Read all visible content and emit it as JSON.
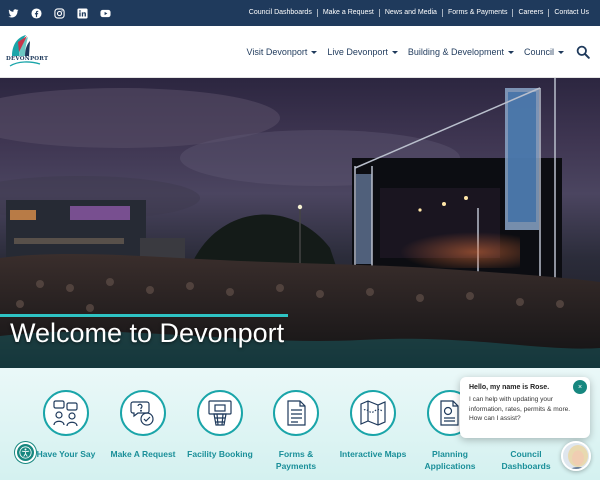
{
  "social": {
    "icons": [
      "twitter-icon",
      "facebook-icon",
      "instagram-icon",
      "linkedin-icon",
      "youtube-icon"
    ]
  },
  "utility_nav": {
    "links": [
      "Council Dashboards",
      "Make a Request",
      "News and Media",
      "Forms & Payments",
      "Careers",
      "Contact Us"
    ]
  },
  "header": {
    "logo_text": "DEVONPORT",
    "nav": [
      {
        "label": "Visit Devonport"
      },
      {
        "label": "Live Devonport"
      },
      {
        "label": "Building & Development"
      },
      {
        "label": "Council"
      }
    ],
    "search_icon": "search-icon"
  },
  "hero": {
    "title": "Welcome to Devonport"
  },
  "quick_links": [
    {
      "label": "Have Your Say",
      "icon": "people-chat-icon"
    },
    {
      "label": "Make A Request",
      "icon": "question-check-icon"
    },
    {
      "label": "Facility Booking",
      "icon": "basketball-hoop-icon"
    },
    {
      "label": "Forms & Payments",
      "icon": "document-icon"
    },
    {
      "label": "Interactive Maps",
      "icon": "map-icon"
    },
    {
      "label": "Planning Applications",
      "icon": "plan-document-icon"
    },
    {
      "label": "Council Dashboards",
      "icon": "dashboard-icon"
    }
  ],
  "chat": {
    "title": "Hello, my name is Rose.",
    "message": "I can help with updating your information, rates, permits & more. How can I assist?",
    "close": "×"
  },
  "colors": {
    "topbar": "#1f3a5c",
    "accent": "#1aa5a9",
    "quick_bg": "#d4f1f0"
  }
}
